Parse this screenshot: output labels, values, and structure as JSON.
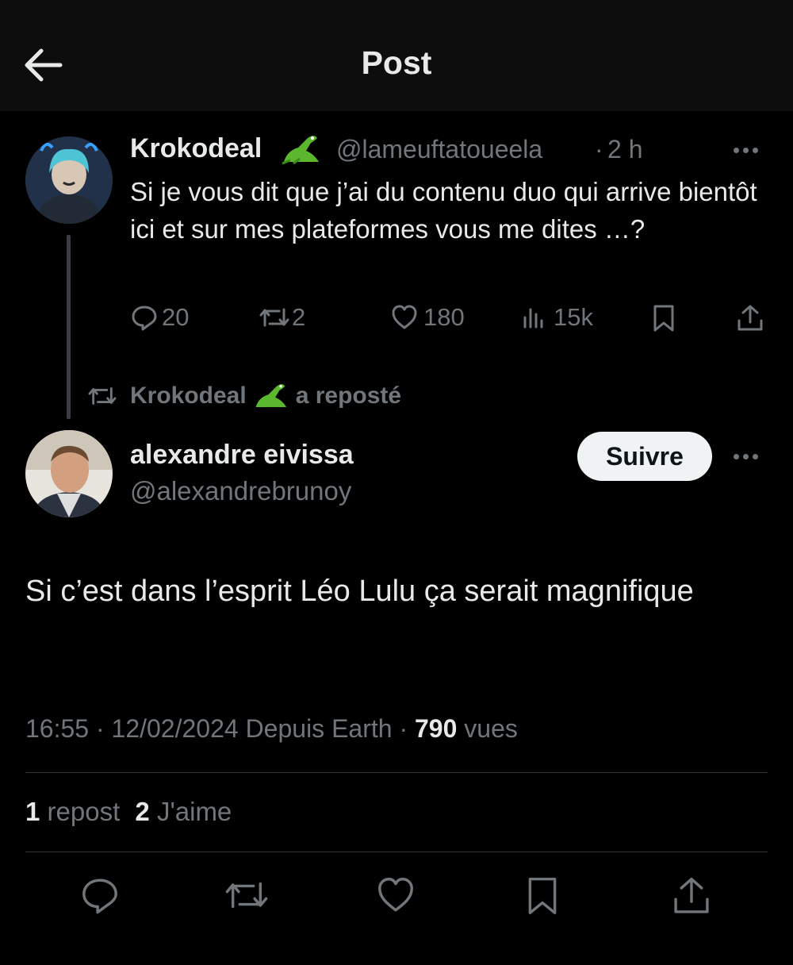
{
  "header": {
    "title": "Post"
  },
  "quoted": {
    "name": "Krokodeal",
    "handle": "@lameuftatoueela",
    "separator": "·",
    "time": "2 h",
    "text": "Si je vous dit que j’ai du contenu duo qui arrive bientôt ici et sur mes plateformes vous me dites …?",
    "replies": "20",
    "reposts": "2",
    "likes": "180",
    "views": "15k"
  },
  "repost_banner": {
    "name": "Krokodeal",
    "suffix": "a reposté"
  },
  "author": {
    "name": "alexandre eivissa",
    "handle": "@alexandrebrunoy",
    "follow_label": "Suivre"
  },
  "post": {
    "text": "Si c’est dans l’esprit Léo Lulu ça serait magnifique",
    "time": "16:55",
    "sep1": "·",
    "date": "12/02/2024",
    "source": "Depuis Earth",
    "sep2": "·",
    "views_count": "790",
    "views_label": "vues"
  },
  "stats": {
    "reposts_count": "1",
    "reposts_label": "repost",
    "likes_count": "2",
    "likes_label": "J'aime"
  },
  "icons": {
    "back": "arrow-left-icon",
    "reply": "reply-icon",
    "repost": "repost-icon",
    "like": "heart-icon",
    "views": "views-icon",
    "bookmark": "bookmark-icon",
    "share": "share-icon",
    "more": "more-icon",
    "emoji": "crocodile-emoji"
  },
  "colors": {
    "background": "#000000",
    "header": "#0d0d0d",
    "text": "#e7e9ea",
    "muted": "#71767b",
    "follow_bg": "#eff3f4"
  }
}
